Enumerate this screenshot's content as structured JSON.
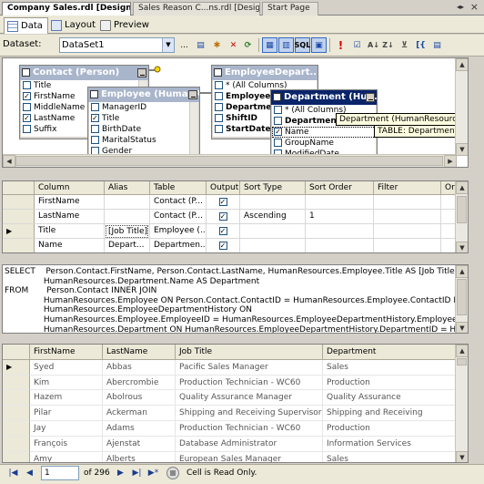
{
  "doc_tabs": [
    {
      "label": "Company Sales.rdl [Design]*",
      "active": true
    },
    {
      "label": "Sales Reason C...ns.rdl [Design]",
      "active": false
    },
    {
      "label": "Start Page",
      "active": false
    }
  ],
  "sub_tabs": [
    {
      "label": "Data",
      "active": true,
      "icon": "data-grid-icon"
    },
    {
      "label": "Layout",
      "active": false,
      "icon": "layout-icon"
    },
    {
      "label": "Preview",
      "active": false,
      "icon": "preview-icon"
    }
  ],
  "toolbar": {
    "dataset_label": "Dataset:",
    "dataset_value": "DataSet1",
    "buttons": [
      "ellipsis-button",
      "edit-dataset-icon",
      "new-dataset-icon",
      "delete-dataset-icon",
      "refresh-fields-icon",
      "show-diagram-pane-icon",
      "show-grid-pane-icon",
      "show-sql-pane-icon",
      "show-results-pane-icon",
      "run-icon",
      "verify-sql-icon",
      "sort-ascending-icon",
      "sort-descending-icon",
      "remove-filter-icon",
      "group-by-icon",
      "add-table-icon"
    ],
    "sql_label": "SQL"
  },
  "diagram": {
    "tables": [
      {
        "title": "Contact (Person)",
        "columns": [
          {
            "name": "Title",
            "checked": false,
            "bold": false
          },
          {
            "name": "FirstName",
            "checked": true,
            "bold": false
          },
          {
            "name": "MiddleName",
            "checked": false,
            "bold": false
          },
          {
            "name": "LastName",
            "checked": true,
            "bold": false
          },
          {
            "name": "Suffix",
            "checked": false,
            "bold": false
          }
        ]
      },
      {
        "title": "Employee (HumanR...",
        "columns": [
          {
            "name": "ManagerID",
            "checked": false,
            "bold": false
          },
          {
            "name": "Title",
            "checked": true,
            "bold": false
          },
          {
            "name": "BirthDate",
            "checked": false,
            "bold": false
          },
          {
            "name": "MaritalStatus",
            "checked": false,
            "bold": false
          },
          {
            "name": "Gender",
            "checked": false,
            "bold": false
          }
        ]
      },
      {
        "title": "EmployeeDepart...",
        "columns": [
          {
            "name": "* (All Columns)",
            "checked": false,
            "bold": false
          },
          {
            "name": "EmployeeID",
            "checked": false,
            "bold": true
          },
          {
            "name": "Department",
            "checked": false,
            "bold": true
          },
          {
            "name": "ShiftID",
            "checked": false,
            "bold": true
          },
          {
            "name": "StartDate",
            "checked": false,
            "bold": true
          }
        ]
      },
      {
        "title": "Department (Hu...",
        "columns": [
          {
            "name": "* (All Columns)",
            "checked": false,
            "bold": false
          },
          {
            "name": "DepartmentID",
            "checked": false,
            "bold": true
          },
          {
            "name": "Name",
            "checked": true,
            "bold": false
          },
          {
            "name": "GroupName",
            "checked": false,
            "bold": false
          },
          {
            "name": "ModifiedDate",
            "checked": false,
            "bold": false
          }
        ]
      }
    ],
    "tooltip_table": "Department (HumanResources)",
    "tooltip_detail": "TABLE: Department (HumanRes"
  },
  "criteria": {
    "headers": [
      "Column",
      "Alias",
      "Table",
      "Output",
      "Sort Type",
      "Sort Order",
      "Filter",
      "Or..."
    ],
    "rows": [
      {
        "column": "FirstName",
        "alias": "",
        "table": "Contact (P...",
        "output": true,
        "sort_type": "",
        "sort_order": "",
        "filter": "",
        "current": false
      },
      {
        "column": "LastName",
        "alias": "",
        "table": "Contact (P...",
        "output": true,
        "sort_type": "Ascending",
        "sort_order": "1",
        "filter": "",
        "current": false
      },
      {
        "column": "Title",
        "alias": "[Job Title]",
        "table": "Employee (...",
        "output": true,
        "sort_type": "",
        "sort_order": "",
        "filter": "",
        "current": true
      },
      {
        "column": "Name",
        "alias": "Depart...",
        "table": "Departmen...",
        "output": true,
        "sort_type": "",
        "sort_order": "",
        "filter": "",
        "current": false
      }
    ]
  },
  "sql": {
    "lines": [
      "SELECT    Person.Contact.FirstName, Person.Contact.LastName, HumanResources.Employee.Title AS [Job Title],",
      "               HumanResources.Department.Name AS Department",
      "FROM       Person.Contact INNER JOIN",
      "               HumanResources.Employee ON Person.Contact.ContactID = HumanResources.Employee.ContactID INNER JOIN",
      "               HumanResources.EmployeeDepartmentHistory ON",
      "               HumanResources.Employee.EmployeeID = HumanResources.EmployeeDepartmentHistory.EmployeeID INNER JOIN",
      "               HumanResources.Department ON HumanResources.EmployeeDepartmentHistory.DepartmentID = HumanResources.De"
    ]
  },
  "results": {
    "headers": [
      "FirstName",
      "LastName",
      "Job Title",
      "Department"
    ],
    "rows": [
      [
        "Syed",
        "Abbas",
        "Pacific Sales Manager",
        "Sales"
      ],
      [
        "Kim",
        "Abercrombie",
        "Production Technician - WC60",
        "Production"
      ],
      [
        "Hazem",
        "Abolrous",
        "Quality Assurance Manager",
        "Quality Assurance"
      ],
      [
        "Pilar",
        "Ackerman",
        "Shipping and Receiving Supervisor",
        "Shipping and Receiving"
      ],
      [
        "Jay",
        "Adams",
        "Production Technician - WC60",
        "Production"
      ],
      [
        "François",
        "Ajenstat",
        "Database Administrator",
        "Information Services"
      ],
      [
        "Amy",
        "Alberts",
        "European Sales Manager",
        "Sales"
      ]
    ]
  },
  "navigation": {
    "current_record": "1",
    "of_total": "of 296",
    "status": "Cell is Read Only."
  }
}
